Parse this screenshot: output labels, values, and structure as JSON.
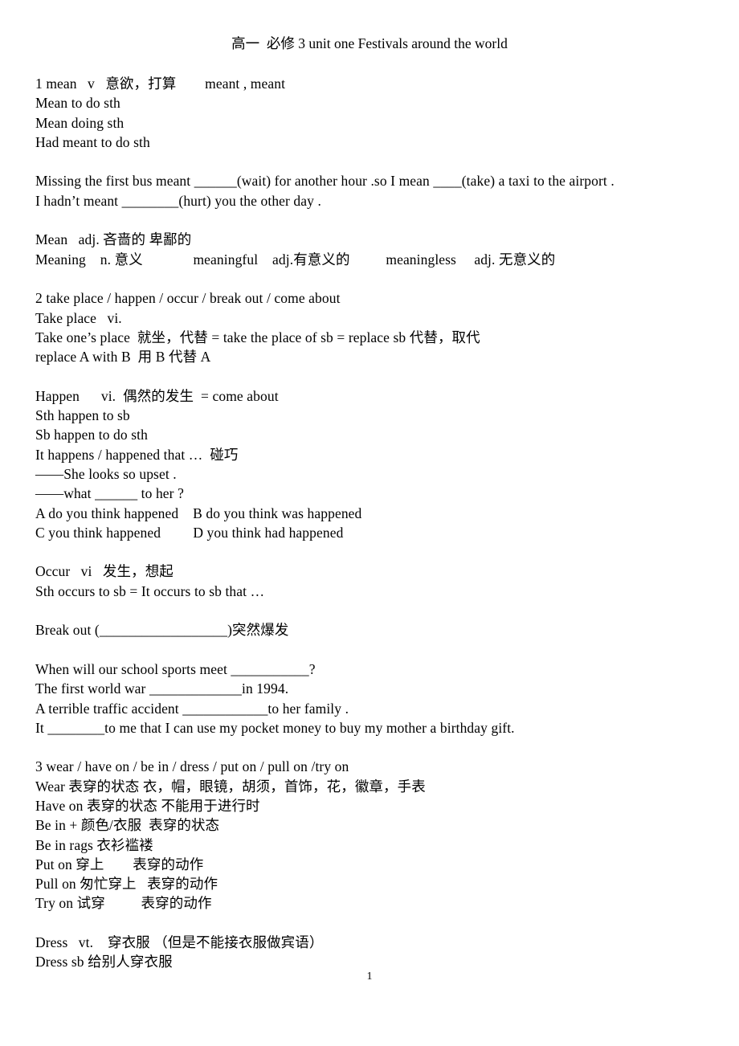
{
  "document": {
    "title": "高一  必修 3 unit one Festivals around the world",
    "page_number": "1",
    "lines": [
      {
        "id": "l1",
        "text": "1 mean   v   意欲，打算        meant , meant"
      },
      {
        "id": "l2",
        "text": "Mean to do sth"
      },
      {
        "id": "l3",
        "text": "Mean doing sth"
      },
      {
        "id": "l4",
        "text": "Had meant to do sth"
      },
      {
        "id": "l5",
        "text": ""
      },
      {
        "id": "l6",
        "text": "Missing the first bus meant ______(wait) for another hour .so I mean ____(take) a taxi to the airport ."
      },
      {
        "id": "l7",
        "text": "I hadn’t meant ________(hurt) you the other day ."
      },
      {
        "id": "l8",
        "text": ""
      },
      {
        "id": "l9",
        "text": "Mean   adj. 吝啬的 卑鄙的"
      },
      {
        "id": "l10",
        "text": "Meaning    n. 意义              meaningful    adj.有意义的          meaningless     adj. 无意义的"
      },
      {
        "id": "l11",
        "text": ""
      },
      {
        "id": "l12",
        "text": "2 take place / happen / occur / break out / come about"
      },
      {
        "id": "l13",
        "text": "Take place   vi."
      },
      {
        "id": "l14",
        "text": "Take one’s place  就坐，代替 = take the place of sb = replace sb 代替，取代"
      },
      {
        "id": "l15",
        "text": "replace A with B  用 B 代替 A"
      },
      {
        "id": "l16",
        "text": ""
      },
      {
        "id": "l17",
        "text": "Happen      vi.  偶然的发生  = come about"
      },
      {
        "id": "l18",
        "text": "Sth happen to sb"
      },
      {
        "id": "l19",
        "text": "Sb happen to do sth"
      },
      {
        "id": "l20",
        "text": "It happens / happened that …  碰巧"
      },
      {
        "id": "l21",
        "text": "——She looks so upset ."
      },
      {
        "id": "l22",
        "text": "——what ______ to her ?"
      },
      {
        "id": "l23",
        "text": "A do you think happened    B do you think was happened"
      },
      {
        "id": "l24",
        "text": "C you think happened         D you think had happened"
      },
      {
        "id": "l25",
        "text": ""
      },
      {
        "id": "l26",
        "text": "Occur   vi   发生，想起"
      },
      {
        "id": "l27",
        "text": "Sth occurs to sb = It occurs to sb that …"
      },
      {
        "id": "l28",
        "text": ""
      },
      {
        "id": "l29",
        "text": "Break out (__________________)突然爆发"
      },
      {
        "id": "l30",
        "text": ""
      },
      {
        "id": "l31",
        "text": "When will our school sports meet ___________?"
      },
      {
        "id": "l32",
        "text": "The first world war _____________in 1994."
      },
      {
        "id": "l33",
        "text": "A terrible traffic accident ____________to her family ."
      },
      {
        "id": "l34",
        "text": "It ________to me that I can use my pocket money to buy my mother a birthday gift."
      },
      {
        "id": "l35",
        "text": ""
      },
      {
        "id": "l36",
        "text": "3 wear / have on / be in / dress / put on / pull on /try on"
      },
      {
        "id": "l37",
        "text": "Wear 表穿的状态 衣，帽，眼镜，胡须，首饰，花，徽章，手表"
      },
      {
        "id": "l38",
        "text": "Have on 表穿的状态 不能用于进行时"
      },
      {
        "id": "l39",
        "text": "Be in + 颜色/衣服  表穿的状态"
      },
      {
        "id": "l40",
        "text": "Be in rags 衣衫褴褛"
      },
      {
        "id": "l41",
        "text": "Put on 穿上        表穿的动作"
      },
      {
        "id": "l42",
        "text": "Pull on 匆忙穿上   表穿的动作"
      },
      {
        "id": "l43",
        "text": "Try on 试穿          表穿的动作"
      },
      {
        "id": "l44",
        "text": ""
      },
      {
        "id": "l45",
        "text": "Dress   vt.    穿衣服 （但是不能接衣服做宾语）"
      },
      {
        "id": "l46",
        "text": "Dress sb 给别人穿衣服"
      }
    ]
  }
}
